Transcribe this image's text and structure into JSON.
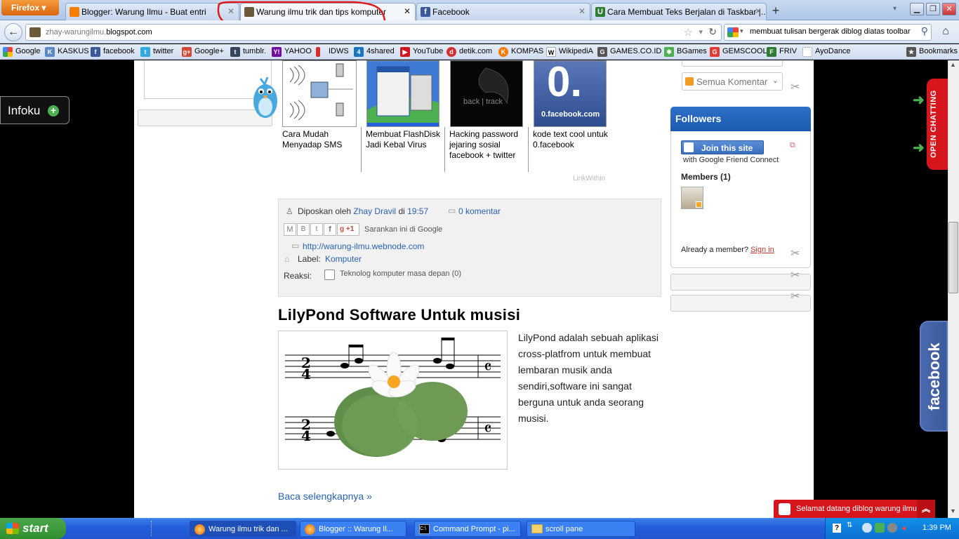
{
  "browser": {
    "app_button": "Firefox",
    "tabs": [
      {
        "label": "Blogger: Warung Ilmu - Buat entri",
        "active": false
      },
      {
        "label": "Warung ilmu trik dan tips komputer",
        "active": true
      },
      {
        "label": "Facebook",
        "active": false
      },
      {
        "label": "Cara Membuat Teks Berjalan di Taskbar |...",
        "active": false
      }
    ],
    "url_grey": "zhay-warungilmu.",
    "url_black": "blogspot.com",
    "search_value": "membuat tulisan bergerak diblog diatas toolbar",
    "bookmarks": [
      "Google",
      "KASKUS",
      "facebook",
      "twitter",
      "Google+",
      "tumblr.",
      "YAHOO",
      "IDWS",
      "4shared",
      "YouTube",
      "detik.com",
      "KOMPAS",
      "WikipediA",
      "GAMES.CO.ID",
      "BGames",
      "GEMSCOOL",
      "FRIV",
      "AyoDance"
    ],
    "bookmarks_menu": "Bookmarks"
  },
  "left_widget": {
    "label": "Infoku"
  },
  "related": {
    "items": [
      "Cara Mudah Menyadap SMS",
      "Membuat FlashDisk Jadi Kebal Virus",
      "Hacking password jejaring sosial facebook + twitter",
      "kode text cool untuk 0.facebook"
    ],
    "thumb4_big": "0.",
    "thumb4_small": "0.facebook.com",
    "thumb3_text": "back | track",
    "credit": "LinkWithin"
  },
  "post_footer": {
    "posted_by": "Diposkan oleh",
    "author": "Zhay Dravil",
    "at": "di",
    "time": "19:57",
    "comments": "0 komentar",
    "share_plus": "+1",
    "share_text": "Sarankan ini di Google",
    "backlink": "http://warung-ilmu.webnode.com",
    "label_prefix": "Label:",
    "label": "Komputer",
    "reactions_label": "Reaksi:",
    "reaction_option": "Teknolog komputer masa depan (0)"
  },
  "post": {
    "title": "LilyPond Software Untuk musisi",
    "body": "LilyPond adalah sebuah aplikasi cross-platfrom untuk membuat lembaran musik anda sendiri,software ini sangat berguna untuk anda seorang musisi.",
    "read_more": "Baca selengkapnya »"
  },
  "sidebar": {
    "select_value": "Semua Komentar",
    "followers_title": "Followers",
    "join_button": "Join this site",
    "join_sub": "with Google Friend Connect",
    "members": "Members (1)",
    "already": "Already a member?",
    "signin": "Sign in"
  },
  "right_widgets": {
    "open_chatting": "OPEN CHATTING",
    "facebook": "facebook"
  },
  "welcome_bar": "Selamat datang diblog warung ilmu",
  "taskbar": {
    "start": "start",
    "tasks": [
      "Warung ilmu trik dan ...",
      "Blogger :: Warung Il...",
      "Command Prompt - pi...",
      "scroll pane"
    ],
    "clock": "1:39 PM"
  },
  "colors": {
    "blogger_blue": "#2a61b2",
    "followers_header": "#1b5cb2",
    "annotation_red": "#e0191b",
    "taskbar_blue": "#245edb"
  }
}
